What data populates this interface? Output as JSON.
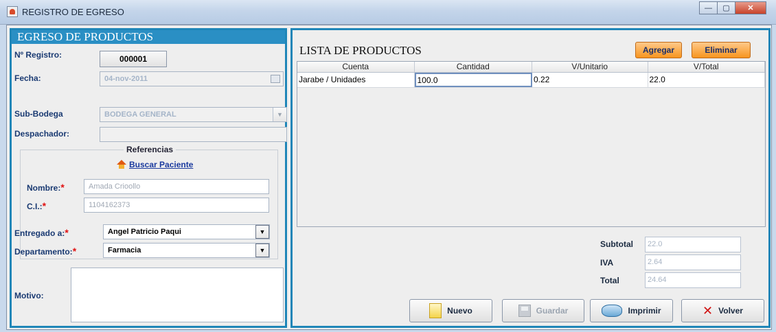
{
  "window": {
    "title": "REGISTRO DE EGRESO"
  },
  "left": {
    "header": "EGRESO DE PRODUCTOS",
    "registro_label": "Nº Registro:",
    "registro_value": "000001",
    "fecha_label": "Fecha:",
    "fecha_value": "04-nov-2011",
    "subbodega_label": "Sub-Bodega",
    "subbodega_value": "BODEGA GENERAL",
    "despachador_label": "Despachador:",
    "despachador_value": "",
    "referencias_title": "Referencias",
    "buscar_link": "Buscar Paciente",
    "nombre_label": "Nombre:",
    "nombre_value": "Amada Crioollo",
    "ci_label": "C.I.:",
    "ci_value": "1104162373",
    "entregado_label": "Entregado a:",
    "entregado_value": "Angel Patricio Paqui",
    "departamento_label": "Departamento:",
    "departamento_value": "Farmacia",
    "motivo_label": "Motivo:",
    "required_mark": "*"
  },
  "right": {
    "title": "LISTA DE PRODUCTOS",
    "agregar": "Agregar",
    "eliminar": "Eliminar",
    "columns": [
      "Cuenta",
      "Cantidad",
      "V/Unitario",
      "V/Total"
    ],
    "rows": [
      [
        "Jarabe / Unidades",
        "100.0",
        "0.22",
        "22.0"
      ]
    ],
    "subtotal_label": "Subtotal",
    "subtotal_value": "22.0",
    "iva_label": "IVA",
    "iva_value": "2.64",
    "total_label": "Total",
    "total_value": "24.64"
  },
  "buttons": {
    "nuevo": "Nuevo",
    "guardar": "Guardar",
    "imprimir": "Imprimir",
    "volver": "Volver"
  },
  "colors": {
    "panel_border": "#1f86b8",
    "header_bg": "#2a8fc4",
    "accent_orange": "#f7951f",
    "required": "#e01010"
  }
}
